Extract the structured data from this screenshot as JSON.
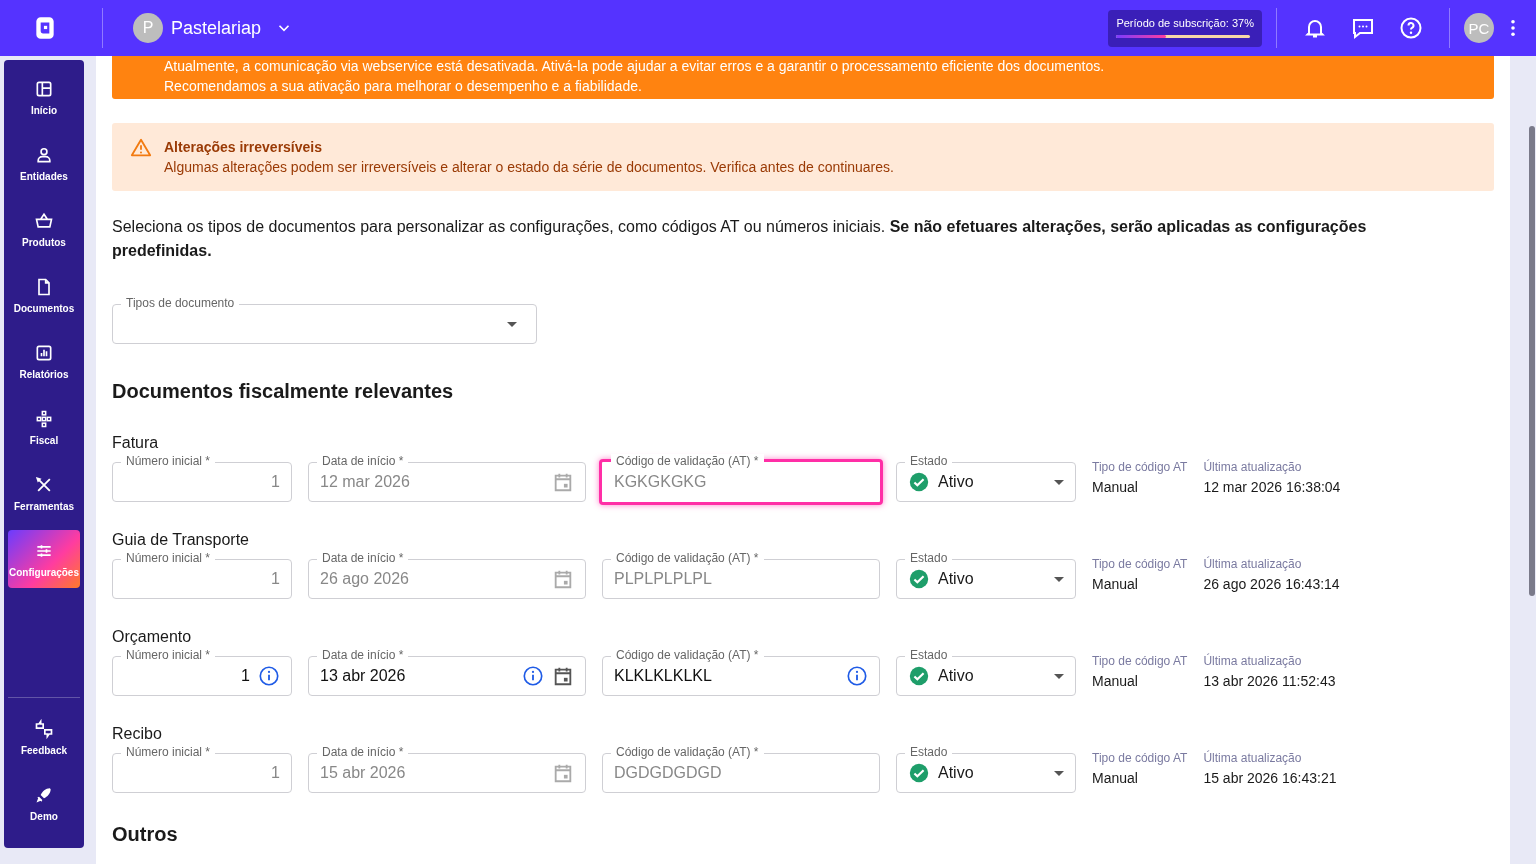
{
  "header": {
    "company": {
      "initial": "P",
      "name": "Pastelariap"
    },
    "subscription": {
      "label": "Período de subscrição: 37%",
      "level": 0.37
    },
    "user_initials": "PC"
  },
  "sidebar": {
    "items": [
      {
        "label": "Início",
        "selected": false
      },
      {
        "label": "Entidades",
        "selected": false
      },
      {
        "label": "Produtos",
        "selected": false
      },
      {
        "label": "Documentos",
        "selected": false
      },
      {
        "label": "Relatórios",
        "selected": false
      },
      {
        "label": "Fiscal",
        "selected": false
      },
      {
        "label": "Ferramentas",
        "selected": false
      },
      {
        "label": "Configurações",
        "selected": true
      }
    ],
    "bottom_items": [
      {
        "label": "Feedback",
        "selected": false
      },
      {
        "label": "Demo",
        "selected": false
      }
    ]
  },
  "webservice_banner": {
    "lines": [
      "Atualmente, a comunicação via webservice está desativada. Ativá-la pode ajudar a evitar erros e a garantir o processamento eficiente dos documentos.",
      "Recomendamos a sua ativação para melhorar o desempenho e a fiabilidade."
    ]
  },
  "warning": {
    "title": "Alterações irreversíveis",
    "text": "Algumas alterações podem ser irreversíveis e alterar o estado da série de documentos. Verifica antes de continuares."
  },
  "intro": "Seleciona os tipos de documentos para personalizar as configurações, como códigos AT ou números iniciais. **Se não efetuares alterações, serão aplicadas as configurações predefinidas.**",
  "document_types_select": {
    "label": "Tipos de documento"
  },
  "section_title": "Documentos fiscalmente relevantes",
  "documents": [
    {
      "name": "Fatura",
      "disabled": true,
      "number": {
        "label": "Número inicial *",
        "value": "1"
      },
      "start_date": {
        "label": "Data de início *",
        "value": "12 mar 2026"
      },
      "at_code": {
        "label": "Código de validação (AT) *",
        "value": "KGKGKGKG",
        "focused": true
      },
      "status": {
        "label": "Estado",
        "value": "Ativo"
      },
      "code_type": {
        "label": "Tipo de código AT",
        "value": "Manual"
      },
      "last_update": {
        "label": "Última atualização",
        "value": "12 mar 2026 16:38:04"
      }
    },
    {
      "name": "Guia de Transporte",
      "disabled": true,
      "number": {
        "label": "Número inicial *",
        "value": "1"
      },
      "start_date": {
        "label": "Data de início *",
        "value": "26 ago 2026"
      },
      "at_code": {
        "label": "Código de validação (AT) *",
        "value": "PLPLPLPLPL",
        "focused": false
      },
      "status": {
        "label": "Estado",
        "value": "Ativo"
      },
      "code_type": {
        "label": "Tipo de código AT",
        "value": "Manual"
      },
      "last_update": {
        "label": "Última atualização",
        "value": "26 ago 2026 16:43:14"
      }
    },
    {
      "name": "Orçamento",
      "disabled": false,
      "number": {
        "label": "Número inicial *",
        "value": "1"
      },
      "start_date": {
        "label": "Data de início *",
        "value": "13 abr 2026"
      },
      "at_code": {
        "label": "Código de validação (AT) *",
        "value": "KLKLKLKLKL",
        "focused": false
      },
      "status": {
        "label": "Estado",
        "value": "Ativo"
      },
      "code_type": {
        "label": "Tipo de código AT",
        "value": "Manual"
      },
      "last_update": {
        "label": "Última atualização",
        "value": "13 abr 2026 11:52:43"
      }
    },
    {
      "name": "Recibo",
      "disabled": true,
      "number": {
        "label": "Número inicial *",
        "value": "1"
      },
      "start_date": {
        "label": "Data de início *",
        "value": "15 abr 2026"
      },
      "at_code": {
        "label": "Código de validação (AT) *",
        "value": "DGDGDGDGD",
        "focused": false
      },
      "status": {
        "label": "Estado",
        "value": "Ativo"
      },
      "code_type": {
        "label": "Tipo de código AT",
        "value": "Manual"
      },
      "last_update": {
        "label": "Última atualização",
        "value": "15 abr 2026 16:43:21"
      }
    }
  ],
  "next_section_title": "Outros"
}
